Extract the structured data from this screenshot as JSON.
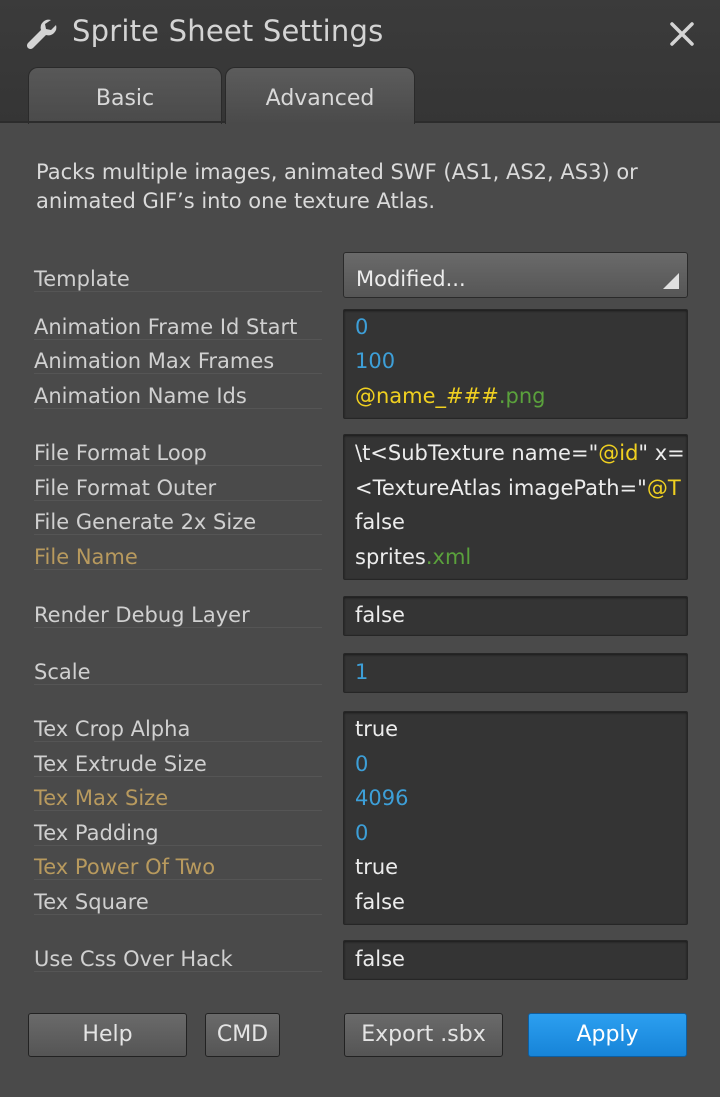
{
  "window": {
    "title": "Sprite Sheet Settings",
    "title_icon": "wrench-icon",
    "close_icon": "close-icon"
  },
  "tabs": [
    {
      "label": "Basic",
      "active": false
    },
    {
      "label": "Advanced",
      "active": true
    }
  ],
  "description": "Packs multiple images, animated SWF (AS1, AS2, AS3) or animated GIF’s into one texture Atlas.",
  "settings": {
    "template": {
      "label": "Template",
      "value": "Modified..."
    },
    "anim_frame_id_start": {
      "label": "Animation Frame Id Start",
      "value": "0"
    },
    "anim_max_frames": {
      "label": "Animation Max Frames",
      "value": "100"
    },
    "anim_name_ids": {
      "label": "Animation Name Ids",
      "value_main": "@name_###",
      "value_ext": ".png"
    },
    "file_format_loop": {
      "label": "File Format Loop",
      "value_pre": "\\t<SubTexture name=\"",
      "value_hl": "@id",
      "value_post": "\" x='"
    },
    "file_format_outer": {
      "label": "File Format Outer",
      "value_pre": "<TextureAtlas imagePath=\"",
      "value_hl": "@T"
    },
    "file_generate_2x": {
      "label": "File Generate 2x Size",
      "value": "false"
    },
    "file_name": {
      "label": "File Name",
      "value_main": "sprites",
      "value_ext": ".xml"
    },
    "render_debug_layer": {
      "label": "Render Debug Layer",
      "value": "false"
    },
    "scale": {
      "label": "Scale",
      "value": "1"
    },
    "tex_crop_alpha": {
      "label": "Tex Crop Alpha",
      "value": "true"
    },
    "tex_extrude_size": {
      "label": "Tex Extrude Size",
      "value": "0"
    },
    "tex_max_size": {
      "label": "Tex Max Size",
      "value": "4096"
    },
    "tex_padding": {
      "label": "Tex Padding",
      "value": "0"
    },
    "tex_power_of_two": {
      "label": "Tex Power Of Two",
      "value": "true"
    },
    "tex_square": {
      "label": "Tex Square",
      "value": "false"
    },
    "use_css_over_hack": {
      "label": "Use Css Over Hack",
      "value": "false"
    }
  },
  "buttons": {
    "help": "Help",
    "cmd": "CMD",
    "export": "Export .sbx",
    "apply": "Apply"
  },
  "colors": {
    "background": "#4a4a4a",
    "number_value": "#3d9fd8",
    "highlight_token": "#f0d020",
    "extension": "#5aa13c",
    "modified_label": "#b89a5e",
    "apply_button": "#2c9ff0"
  }
}
